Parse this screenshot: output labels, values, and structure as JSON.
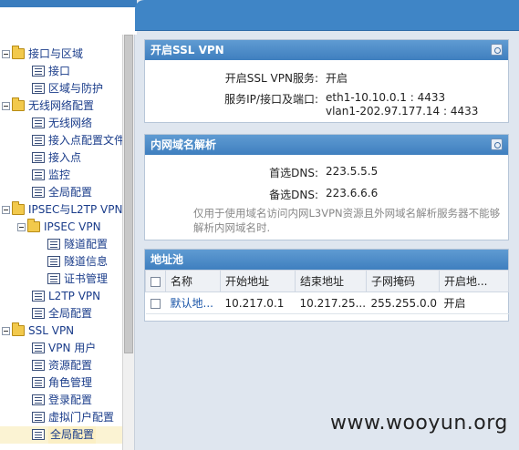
{
  "sidebar": {
    "items": [
      {
        "label": "接口与区域"
      },
      {
        "label": "接口"
      },
      {
        "label": "区域与防护"
      },
      {
        "label": "无线网络配置"
      },
      {
        "label": "无线网络"
      },
      {
        "label": "接入点配置文件"
      },
      {
        "label": "接入点"
      },
      {
        "label": "监控"
      },
      {
        "label": "全局配置"
      },
      {
        "label": "IPSEC与L2TP VPN"
      },
      {
        "label": "IPSEC VPN"
      },
      {
        "label": "隧道配置"
      },
      {
        "label": "隧道信息"
      },
      {
        "label": "证书管理"
      },
      {
        "label": "L2TP VPN"
      },
      {
        "label": "全局配置"
      },
      {
        "label": "SSL VPN"
      },
      {
        "label": "VPN 用户"
      },
      {
        "label": "资源配置"
      },
      {
        "label": "角色管理"
      },
      {
        "label": "登录配置"
      },
      {
        "label": "虚拟门户配置"
      },
      {
        "label": "全局配置"
      }
    ],
    "selected_index": 22
  },
  "ssl_panel": {
    "title": "开启SSL VPN",
    "service_label": "开启SSL VPN服务:",
    "service_value": "开启",
    "port_label": "服务IP/接口及端口:",
    "port_value_1": "eth1-10.10.0.1 : 4433",
    "port_value_2": "vlan1-202.97.177.14 : 4433"
  },
  "dns_panel": {
    "title": "内网域名解析",
    "primary_label": "首选DNS:",
    "primary_value": "223.5.5.5",
    "secondary_label": "备选DNS:",
    "secondary_value": "223.6.6.6",
    "note": "仅用于使用域名访问内网L3VPN资源且外网域名解析服务器不能够解析内网域名时."
  },
  "pool_panel": {
    "title": "地址池",
    "columns": [
      "名称",
      "开始地址",
      "结束地址",
      "子网掩码",
      "开启地..."
    ],
    "rows": [
      {
        "name": "默认地...",
        "start": "10.217.0.1",
        "end": "10.217.25...",
        "mask": "255.255.0.0",
        "enabled": "开启"
      }
    ]
  },
  "watermark": "www.wooyun.org",
  "colors": {
    "accent": "#3f85c6",
    "selected": "#fbf3d3"
  }
}
